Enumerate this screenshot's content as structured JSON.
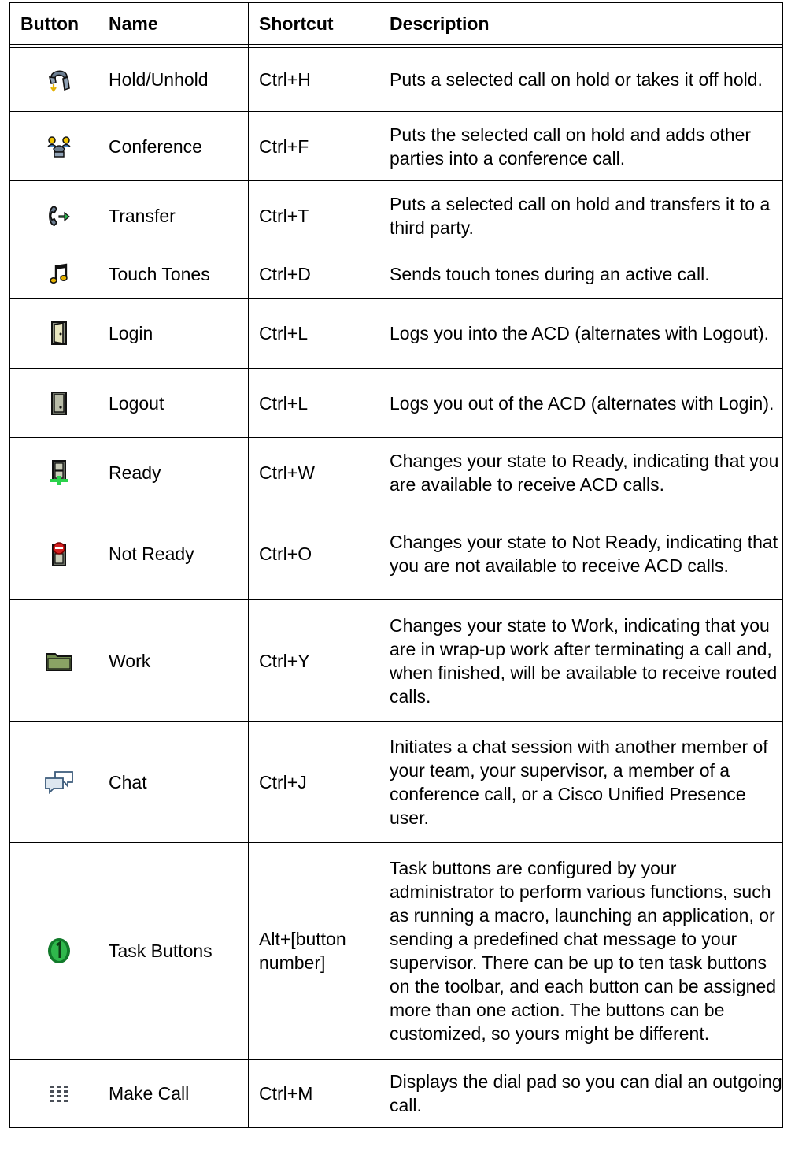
{
  "headers": [
    "Button",
    "Name",
    "Shortcut",
    "Description"
  ],
  "rows": [
    {
      "icon": "hold-unhold-icon",
      "name": "Hold/Unhold",
      "shortcut": "Ctrl+H",
      "description": "Puts a selected call on hold or takes it off hold."
    },
    {
      "icon": "conference-icon",
      "name": "Conference",
      "shortcut": "Ctrl+F",
      "description": "Puts the selected call on hold and adds other parties into a conference call."
    },
    {
      "icon": "transfer-icon",
      "name": "Transfer",
      "shortcut": "Ctrl+T",
      "description": "Puts a selected call on hold and transfers it to a third party."
    },
    {
      "icon": "touch-tones-icon",
      "name": "Touch Tones",
      "shortcut": "Ctrl+D",
      "description": "Sends touch tones during an active call."
    },
    {
      "icon": "login-icon",
      "name": "Login",
      "shortcut": "Ctrl+L",
      "description": "Logs you into the ACD (alternates with Logout)."
    },
    {
      "icon": "logout-icon",
      "name": "Logout",
      "shortcut": "Ctrl+L",
      "description": "Logs you out of the ACD (alternates with Login)."
    },
    {
      "icon": "ready-icon",
      "name": "Ready",
      "shortcut": "Ctrl+W",
      "description": "Changes your state to Ready, indicating that you are available to receive ACD calls."
    },
    {
      "icon": "not-ready-icon",
      "name": "Not Ready",
      "shortcut": "Ctrl+O",
      "description": "Changes your state to Not Ready, indicating that you are not available to receive ACD calls."
    },
    {
      "icon": "work-icon",
      "name": "Work",
      "shortcut": "Ctrl+Y",
      "description": "Changes your state to Work, indicating that you are in wrap-up work after terminating a call and, when finished, will be available to receive routed calls."
    },
    {
      "icon": "chat-icon",
      "name": "Chat",
      "shortcut": "Ctrl+J",
      "description": "Initiates a chat session with another member of your team, your supervisor, a member of a conference call, or a Cisco Unified Presence user."
    },
    {
      "icon": "task-button-icon",
      "name": "Task Buttons",
      "shortcut": "Alt+[button number]",
      "description": "Task buttons are configured by your administrator to perform various functions, such as running a macro, launching an application, or sending a predefined chat message to your supervisor. There can be up to ten task buttons on the toolbar, and each button can be assigned more than one action. The buttons can be customized, so yours might be different."
    },
    {
      "icon": "make-call-icon",
      "name": "Make Call",
      "shortcut": "Ctrl+M",
      "description": "Displays the dial pad so you can dial an outgoing call."
    }
  ]
}
